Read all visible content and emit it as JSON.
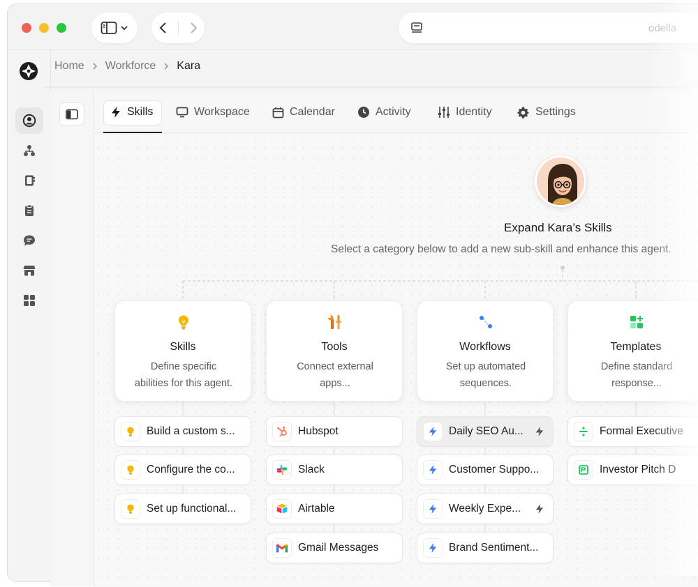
{
  "browser": {
    "address": "odella"
  },
  "breadcrumb": {
    "items": [
      "Home",
      "Workforce",
      "Kara"
    ]
  },
  "tabs": [
    {
      "label": "Skills",
      "icon": "bolt-icon",
      "active": true
    },
    {
      "label": "Workspace",
      "icon": "monitor-icon",
      "active": false
    },
    {
      "label": "Calendar",
      "icon": "calendar-icon",
      "active": false
    },
    {
      "label": "Activity",
      "icon": "clock-icon",
      "active": false
    },
    {
      "label": "Identity",
      "icon": "sliders-icon",
      "active": false
    },
    {
      "label": "Settings",
      "icon": "gear-icon",
      "active": false
    }
  ],
  "main": {
    "heading": "Expand Kara’s Skills",
    "subheading": "Select a category below to add a new sub-skill and enhance this agent."
  },
  "categories": [
    {
      "title": "Skills",
      "desc": "Define specific\nabilities for this agent.",
      "icon": "lightbulb-icon",
      "items": [
        {
          "label": "Build a custom s...",
          "icon": "lightbulb-icon"
        },
        {
          "label": "Configure the co...",
          "icon": "lightbulb-icon"
        },
        {
          "label": "Set up functional...",
          "icon": "lightbulb-icon"
        }
      ]
    },
    {
      "title": "Tools",
      "desc": "Connect external\napps...",
      "icon": "tools-icon",
      "items": [
        {
          "label": "Hubspot",
          "icon": "hubspot-icon"
        },
        {
          "label": "Slack",
          "icon": "slack-icon"
        },
        {
          "label": "Airtable",
          "icon": "airtable-icon"
        },
        {
          "label": "Gmail Messages",
          "icon": "gmail-icon"
        }
      ]
    },
    {
      "title": "Workflows",
      "desc": "Set up automated\nsequences.",
      "icon": "workflow-icon",
      "items": [
        {
          "label": "Daily SEO Au...",
          "icon": "bolt-icon"
        },
        {
          "label": "Customer Suppo...",
          "icon": "bolt-icon"
        },
        {
          "label": "Weekly Expe...",
          "icon": "bolt-icon"
        },
        {
          "label": "Brand Sentiment...",
          "icon": "bolt-icon"
        }
      ]
    },
    {
      "title": "Templates",
      "desc": "Define standard\nresponse...",
      "icon": "template-icon",
      "items": [
        {
          "label": "Formal Executive",
          "icon": "divide-icon"
        },
        {
          "label": "Investor Pitch D",
          "icon": "template-doc-icon"
        }
      ]
    }
  ],
  "colors": {
    "accent_blue": "#3b7cf0",
    "bulb_yellow": "#f5b700",
    "template_green": "#22c55e"
  }
}
